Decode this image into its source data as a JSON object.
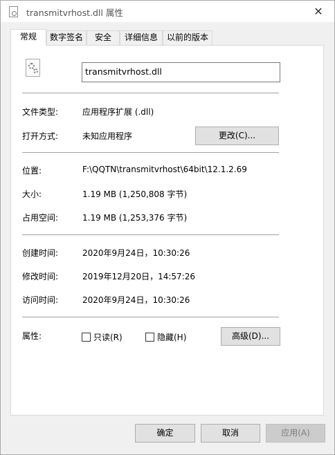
{
  "window": {
    "title": "transmitvrhost.dll 属性",
    "close_glyph": "✕"
  },
  "tabs": [
    {
      "label": "常规",
      "active": true
    },
    {
      "label": "数字签名",
      "active": false
    },
    {
      "label": "安全",
      "active": false
    },
    {
      "label": "详细信息",
      "active": false
    },
    {
      "label": "以前的版本",
      "active": false
    }
  ],
  "general": {
    "file_icon": "dll-gear-icon",
    "filename": "transmitvrhost.dll",
    "file_type_label": "文件类型:",
    "file_type_value": "应用程序扩展 (.dll)",
    "opens_with_label": "打开方式:",
    "opens_with_value": "未知应用程序",
    "change_button": "更改(C)...",
    "location_label": "位置:",
    "location_value": "F:\\QQTN\\transmitvrhost\\64bit\\12.1.2.69",
    "size_label": "大小:",
    "size_value": "1.19 MB (1,250,808 字节)",
    "size_on_disk_label": "占用空间:",
    "size_on_disk_value": "1.19 MB (1,253,376 字节)",
    "created_label": "创建时间:",
    "created_value": "2020年9月24日，10:30:26",
    "modified_label": "修改时间:",
    "modified_value": "2019年12月20日，14:57:26",
    "accessed_label": "访问时间:",
    "accessed_value": "2020年9月24日，10:30:26",
    "attributes_label": "属性:",
    "readonly_label": "只读(R)",
    "readonly_checked": false,
    "hidden_label": "隐藏(H)",
    "hidden_checked": false,
    "advanced_button": "高级(D)..."
  },
  "footer": {
    "ok": "确定",
    "cancel": "取消",
    "apply": "应用(A)"
  }
}
